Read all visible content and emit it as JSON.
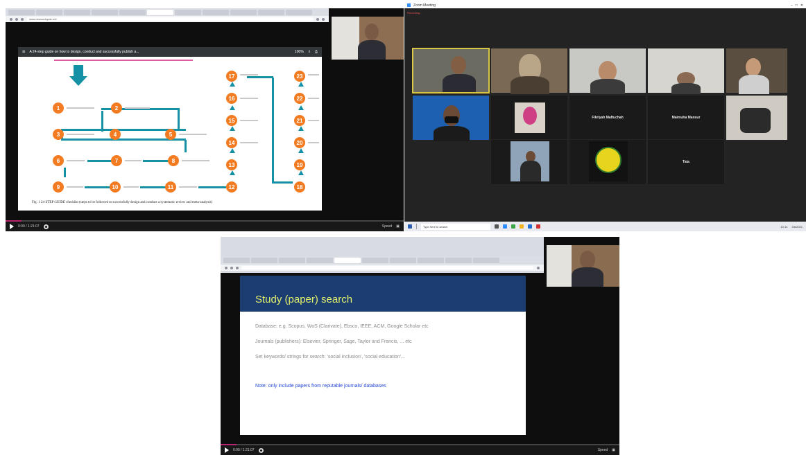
{
  "panel1": {
    "browser_url": "www.researchgate.net",
    "pdf_title": "A 24-step guide on how to design, conduct and successfully publish a...",
    "zoom": "100%",
    "steps": [
      "1",
      "2",
      "3",
      "4",
      "5",
      "6",
      "7",
      "8",
      "9",
      "10",
      "11",
      "12",
      "13",
      "14",
      "15",
      "16",
      "17",
      "18",
      "19",
      "20",
      "21",
      "22",
      "23",
      "24"
    ],
    "caption": "Fig. 1  24-STEP GUIDE checklist (steps to be followed to successfully design and conduct a systematic review and meta-analysis)",
    "player_time": "0:00 / 1:21:07",
    "player_speed": "Speed",
    "progress": 0.04,
    "accent_color": "#f37c22",
    "line_color": "#1591a6"
  },
  "panel2": {
    "window_title": "Zoom Meeting",
    "recording": "Recording...",
    "participants": [
      "Fikriyah Maftuchah",
      "Maimuha Mansur",
      "Tata"
    ],
    "search_placeholder": "Type here to search",
    "time": "10:14",
    "date": "3/6/2021"
  },
  "panel3": {
    "slide_title": "Study (paper) search",
    "slide_lines": [
      "Database: e.g. Scopus, WoS (Clarivate), Ebsco, IEEE, ACM, Google Scholar etc",
      "Journals (publishers): Elsevier, Springer, Sage, Taylor and Francis, ... etc",
      "Set keywords/ strings for search: 'social inclusion', 'social education'..."
    ],
    "note": "Note: only include papers from reputable journals/ databases",
    "player_time": "0:00 / 1:21:07",
    "player_speed": "Speed",
    "progress": 0.04
  }
}
